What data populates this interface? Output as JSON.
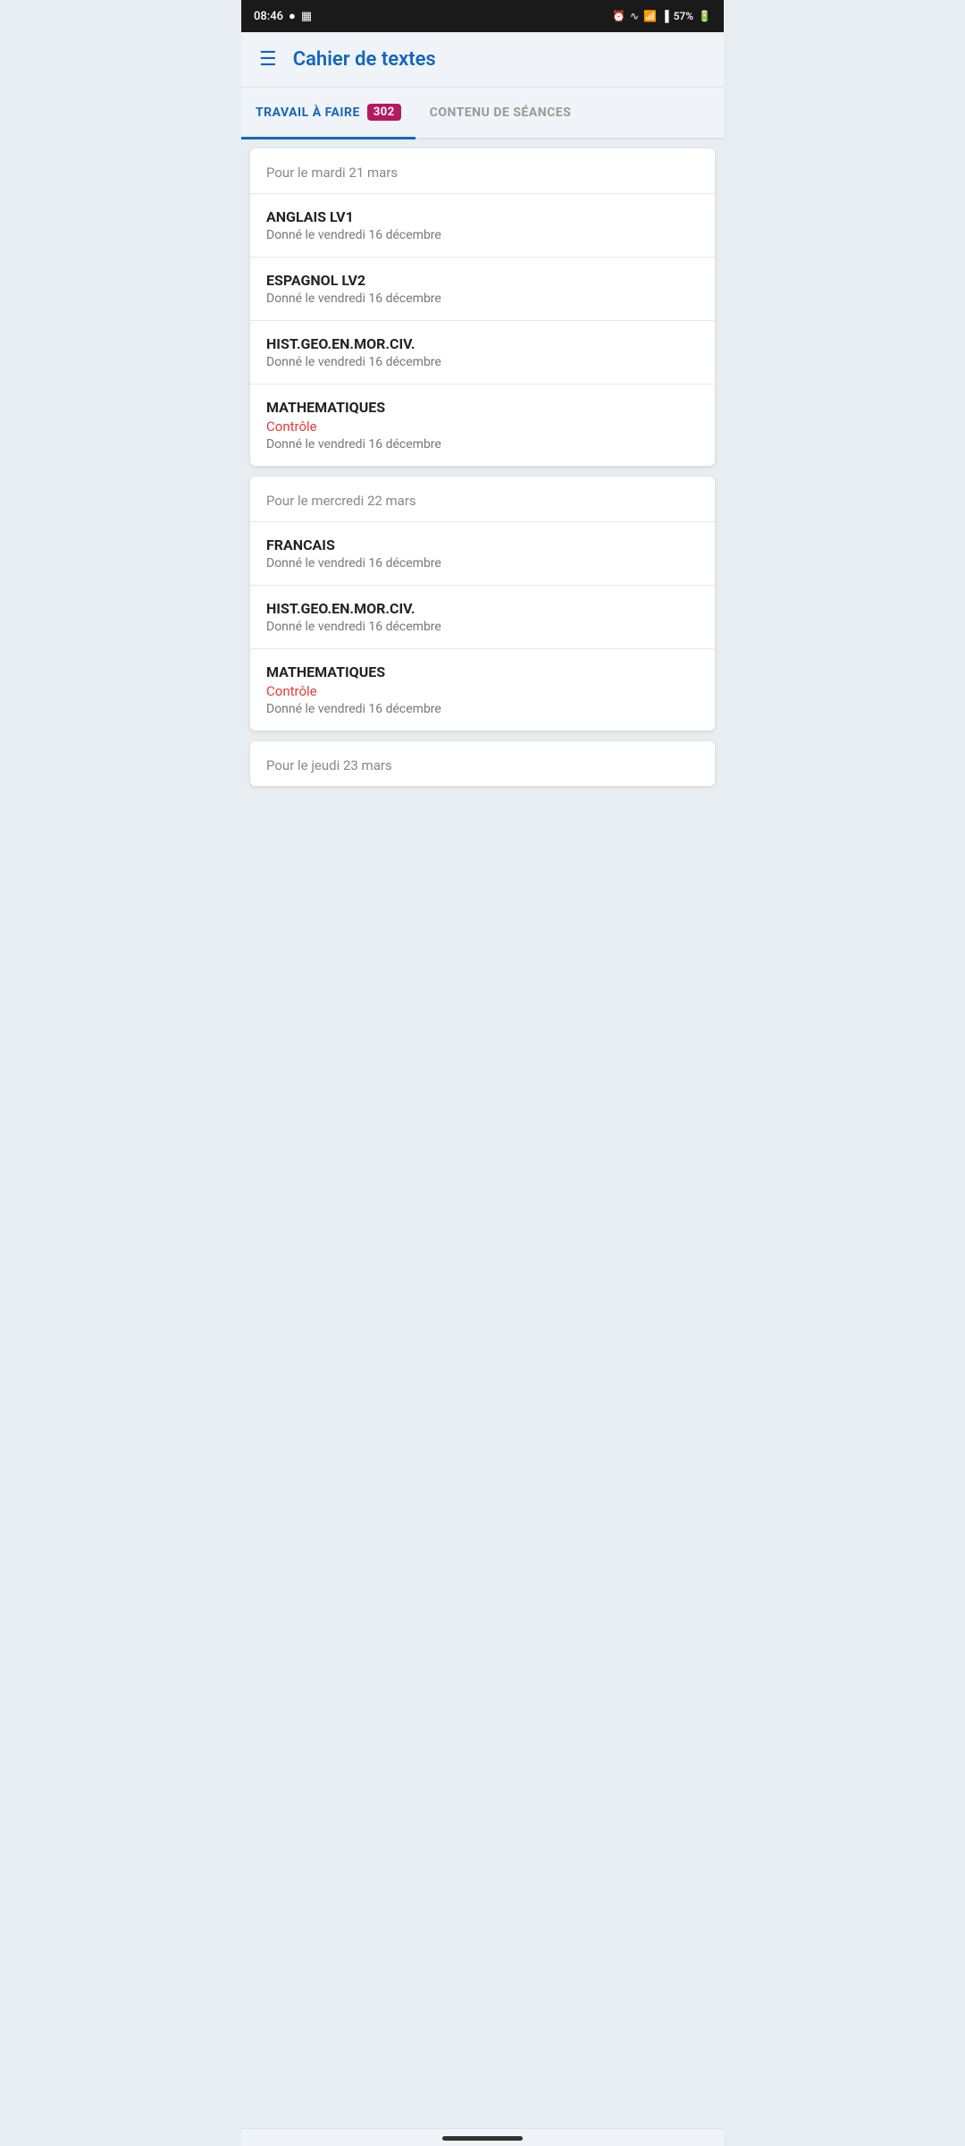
{
  "statusBar": {
    "time": "08:46",
    "icons_left": [
      "location-dot-icon",
      "image-icon"
    ],
    "icons_right": [
      "alarm-icon",
      "wifi-icon",
      "call-icon",
      "signal-icon",
      "battery-icon"
    ],
    "battery": "57%"
  },
  "header": {
    "menu_icon": "☰",
    "title": "Cahier de textes"
  },
  "tabs": [
    {
      "id": "travail-a-faire",
      "label": "TRAVAIL À FAIRE",
      "badge": "302",
      "active": true
    },
    {
      "id": "contenu-de-seances",
      "label": "CONTENU DE SÉANCES",
      "active": false
    }
  ],
  "groups": [
    {
      "date": "Pour le mardi 21 mars",
      "subjects": [
        {
          "name": "ANGLAIS LV1",
          "control": null,
          "given": "Donné le vendredi 16 décembre"
        },
        {
          "name": "ESPAGNOL LV2",
          "control": null,
          "given": "Donné le vendredi 16 décembre"
        },
        {
          "name": "HIST.GEO.EN.MOR.CIV.",
          "control": null,
          "given": "Donné le vendredi 16 décembre"
        },
        {
          "name": "MATHEMATIQUES",
          "control": "Contrôle",
          "given": "Donné le vendredi 16 décembre"
        }
      ]
    },
    {
      "date": "Pour le mercredi 22 mars",
      "subjects": [
        {
          "name": "FRANCAIS",
          "control": null,
          "given": "Donné le vendredi 16 décembre"
        },
        {
          "name": "HIST.GEO.EN.MOR.CIV.",
          "control": null,
          "given": "Donné le vendredi 16 décembre"
        },
        {
          "name": "MATHEMATIQUES",
          "control": "Contrôle",
          "given": "Donné le vendredi 16 décembre"
        }
      ]
    },
    {
      "date": "Pour le jeudi 23 mars",
      "subjects": []
    }
  ]
}
